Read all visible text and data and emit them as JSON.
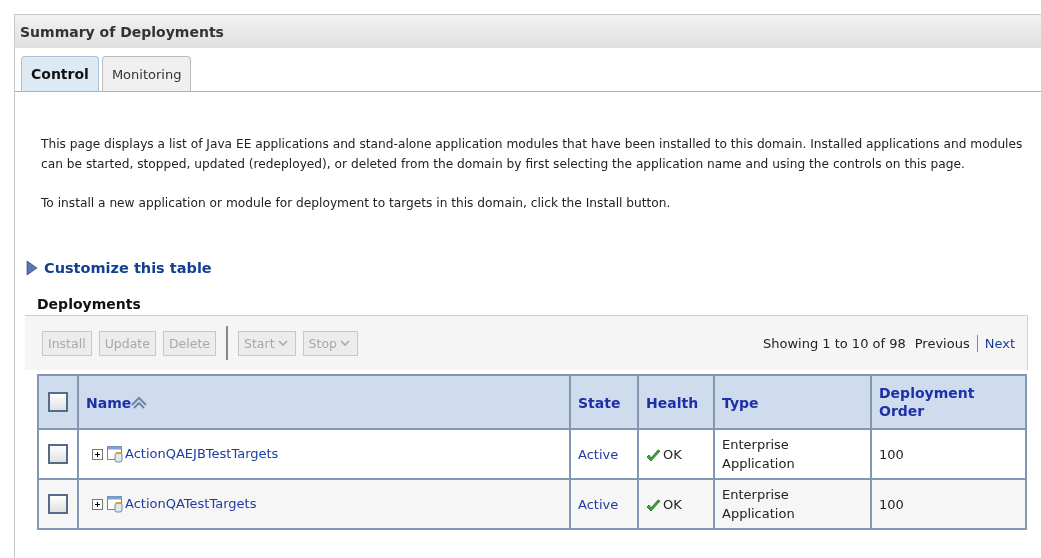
{
  "panel": {
    "title": "Summary of Deployments"
  },
  "tabs": [
    {
      "label": "Control",
      "selected": true
    },
    {
      "label": "Monitoring",
      "selected": false
    }
  ],
  "description": [
    "This page displays a list of Java EE applications and stand-alone application modules that have been installed to this domain. Installed applications and modules can be started, stopped, updated (redeployed), or deleted from the domain by first selecting the application name and using the controls on this page.",
    "To install a new application or module for deployment to targets in this domain, click the Install button."
  ],
  "customize_link": {
    "label": "Customize this table",
    "expanded": false
  },
  "table": {
    "title": "Deployments",
    "toolbar": [
      {
        "label": "Install",
        "kind": "button",
        "disabled": true
      },
      {
        "label": "Update",
        "kind": "button",
        "disabled": true
      },
      {
        "label": "Delete",
        "kind": "button",
        "disabled": true
      },
      {
        "label": "Start",
        "kind": "menu",
        "disabled": true
      },
      {
        "label": "Stop",
        "kind": "menu",
        "disabled": true
      }
    ],
    "pagination": {
      "summary": "Showing 1 to 10 of 98",
      "previous": "Previous",
      "next": "Next"
    },
    "select_all_checked": false,
    "columns": [
      "Name",
      "State",
      "Health",
      "Type",
      "Deployment Order"
    ],
    "rows": [
      {
        "checked": false,
        "expanded": false,
        "name": "ActionQAEJBTestTargets",
        "state": "Active",
        "health": "OK",
        "type": "Enterprise Application",
        "order": "100"
      },
      {
        "checked": false,
        "expanded": false,
        "name": "ActionQATestTargets",
        "state": "Active",
        "health": "OK",
        "type": "Enterprise Application",
        "order": "100"
      }
    ]
  }
}
